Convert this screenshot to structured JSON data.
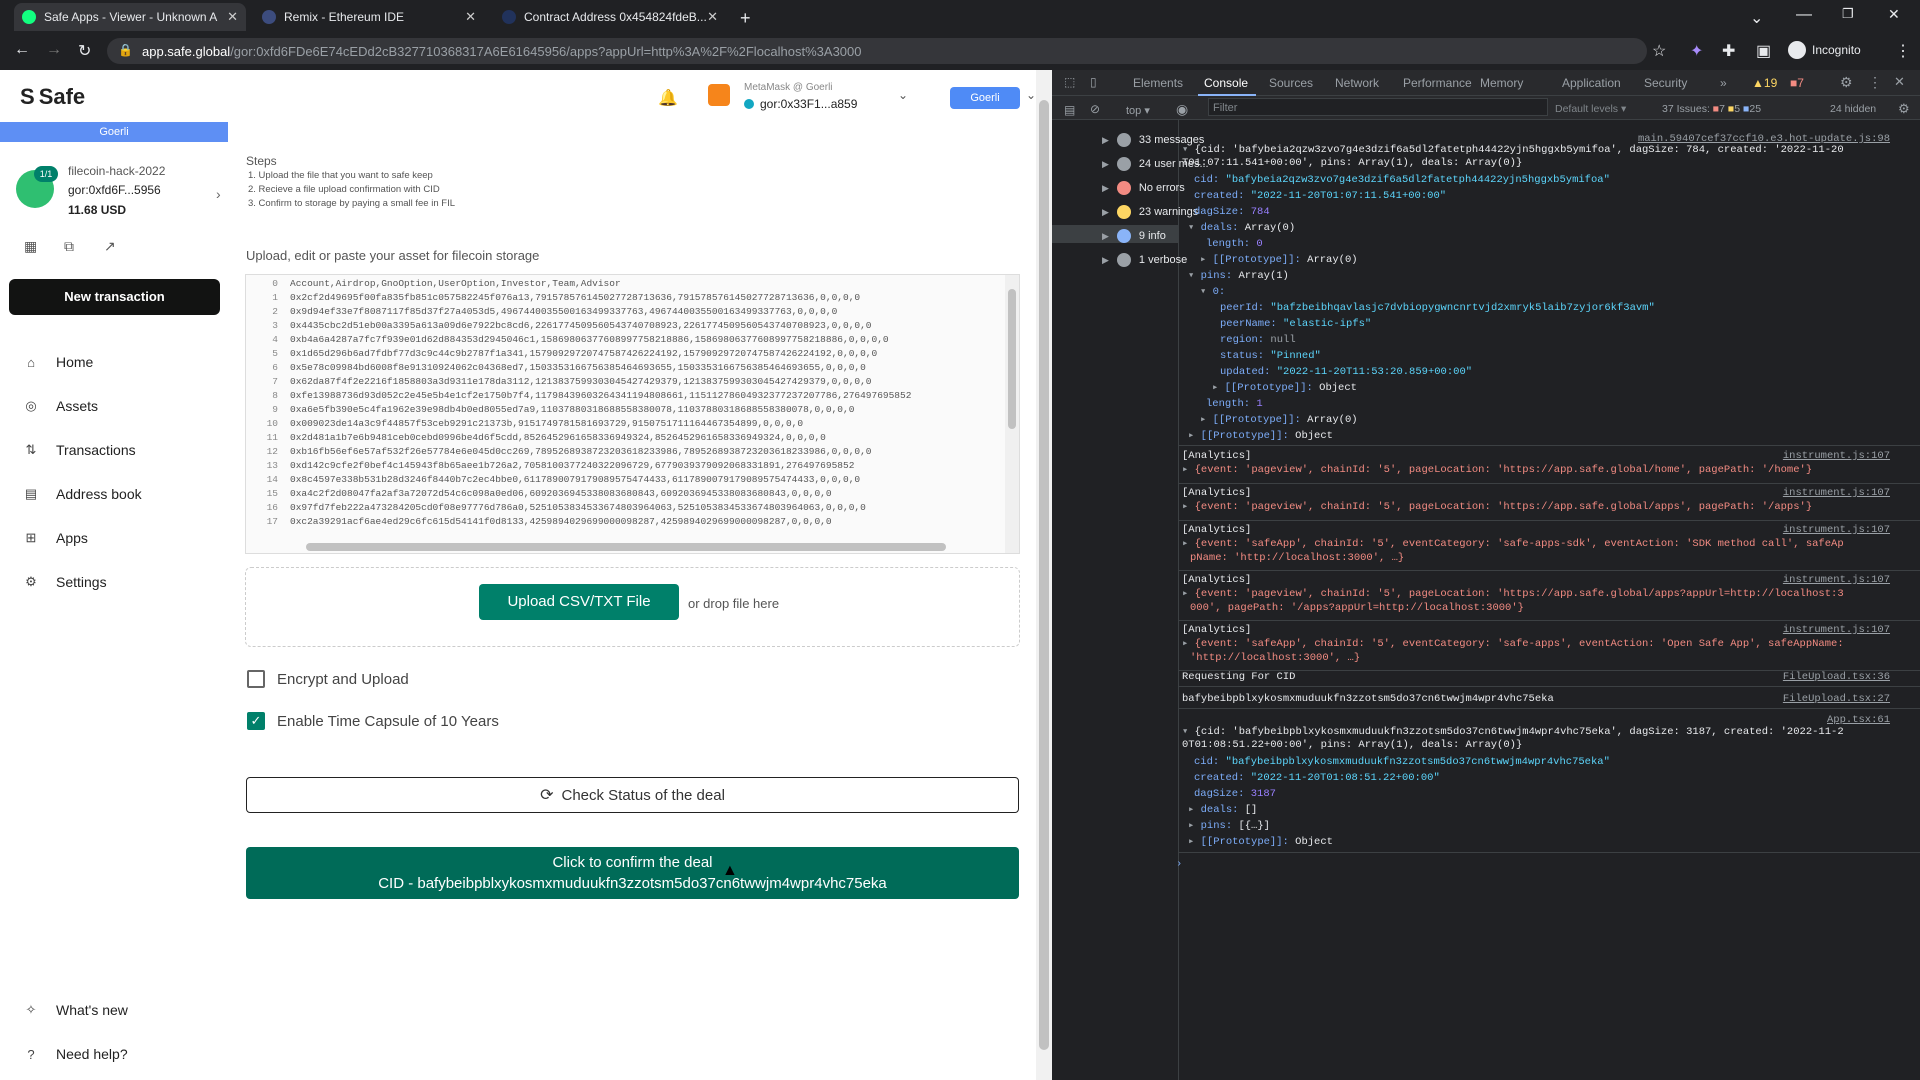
{
  "browser": {
    "tabs": [
      {
        "title": "Safe Apps - Viewer - Unknown A"
      },
      {
        "title": "Remix - Ethereum IDE"
      },
      {
        "title": "Contract Address 0x454824fdeB..."
      }
    ],
    "url_host": "app.safe.global",
    "url_path": "/gor:0xfd6FDe6E74cEDd2cB327710368317A6E61645956/apps?appUrl=http%3A%2F%2Flocalhost%3A3000",
    "profile": "Incognito"
  },
  "safe": {
    "logo": "Safe",
    "network_bar": "Goerli",
    "account": {
      "name": "filecoin-hack-2022",
      "address": "gor:0xfd6F...5956",
      "balance": "11.68 USD",
      "threshold": "1/1"
    },
    "new_tx": "New transaction",
    "nav": [
      {
        "label": "Home",
        "icon": "home-icon"
      },
      {
        "label": "Assets",
        "icon": "assets-icon"
      },
      {
        "label": "Transactions",
        "icon": "transactions-icon"
      },
      {
        "label": "Address book",
        "icon": "address-book-icon"
      },
      {
        "label": "Apps",
        "icon": "apps-icon"
      },
      {
        "label": "Settings",
        "icon": "settings-icon"
      }
    ],
    "whats_new": "What's new",
    "need_help": "Need help?",
    "header": {
      "wallet": "MetaMask @ Goerli",
      "address": "gor:0x33F1...a859",
      "network": "Goerli"
    }
  },
  "app": {
    "steps_title": "Steps",
    "steps": [
      "1. Upload the file that you want to safe keep",
      "2. Recieve a file upload confirmation with CID",
      "3. Confirm to storage by paying a small fee in FIL"
    ],
    "upload_title": "Upload, edit or paste your asset for filecoin storage",
    "csv_lines": [
      "Account,Airdrop,GnoOption,UserOption,Investor,Team,Advisor",
      "0x2cf2d49695f00fa835fb851c057582245f076a13,791578576145027728713636,791578576145027728713636,0,0,0,0",
      "0x9d94ef33e7f8087117f85d37f27a4053d5,4967440035500163499337763,4967440035500163499337763,0,0,0,0",
      "0x4435cbc2d51eb00a3395a613a09d6e7922bc8cd6,2261774509560543740708923,2261774509560543740708923,0,0,0,0",
      "0xb4a6a4287a7fc7f939e01d62d884353d2945046c1,15869806377608997758218886,15869806377608997758218886,0,0,0,0",
      "0x1d65d296b6ad7fdbf77d3c9c44c9b2787f1a341,15790929720747587426224192,15790929720747587426224192,0,0,0,0",
      "0x5e78c09984bd6008f8e91310924062c04368ed7,1503353166756385464693655,1503353166756385464693655,0,0,0,0",
      "0x62da87f4f2e2216f1858803a3d9311e178da3112,1213837599303045427429379,1213837599303045427429379,0,0,0,0",
      "0xfe13988736d93d052c2e45e5b4e1cf2e1750b7f4,11798439603264341194808661,11511278604932377237207786,276497695852",
      "0xa6e5fb390e5c4fa1962e39e98db4b0ed8055ed7a9,11037880318688558380078,11037880318688558380078,0,0,0,0",
      "0x009023de14a3c9f44857f53ceb9291c21373b,9151749781581693729,9150751711164467354899,0,0,0,0",
      "0x2d481a1b7e6b9481ceb0cebd0996be4d6f5cdd,8526452961658336949324,8526452961658336949324,0,0,0,0",
      "0xb16fb56ef6e57af532f26e57784e6e045d0cc269,7895268938723203618233986,7895268938723203618233986,0,0,0,0",
      "0xd142c9cfe2f0bef4c145943f8b65aee1b726a2,7058100377240322096729,6779039379092068331891,276497695852",
      "0x8c4597e338b531b28d3246f8440b7c2ec4bbe0,6117890079179089575474433,6117890079179089575474433,0,0,0,0",
      "0xa4c2f2d08047fa2af3a72072d54c6c098a0ed06,6092036945338083680843,6092036945338083680843,0,0,0,0",
      "0x97fd7feb222a473284205cd0f08e97776d786a0,5251053834533674803964063,5251053834533674803964063,0,0,0,0",
      "0xc2a39291acf6ae4ed29c6fc615d54141f0d8133,4259894029699000098287,4259894029699000098287,0,0,0,0"
    ],
    "upload_button": "Upload CSV/TXT File",
    "drop_text": "or drop file here",
    "encrypt_label": "Encrypt and Upload",
    "encrypt_checked": false,
    "capsule_label": "Enable Time Capsule of 10 Years",
    "capsule_checked": true,
    "check_status": "Check Status of the deal",
    "confirm_line1": "Click to confirm the deal",
    "confirm_line2": "CID - bafybeibpblxykosmxmuduukfn3zzotsm5do37cn6twwjm4wpr4vhc75eka"
  },
  "devtools": {
    "tabs": [
      "Elements",
      "Console",
      "Sources",
      "Network",
      "Performance",
      "Memory",
      "Application",
      "Security"
    ],
    "active_tab": "Console",
    "warn_count": "19",
    "err_count": "7",
    "context": "top",
    "filter_placeholder": "Filter",
    "levels": "Default levels",
    "issues": "37 Issues:",
    "issues_err": "7",
    "issues_warn": "5",
    "issues_info": "25",
    "hidden": "24 hidden",
    "sidebar": [
      {
        "label": "33 messages",
        "color": "#9aa0a6"
      },
      {
        "label": "24 user mes...",
        "color": "#9aa0a6"
      },
      {
        "label": "No errors",
        "color": "#f28b82"
      },
      {
        "label": "23 warnings",
        "color": "#fdd663"
      },
      {
        "label": "9 info",
        "color": "#8ab4f8"
      },
      {
        "label": "1 verbose",
        "color": "#9aa0a6"
      }
    ],
    "src_main": "main.59407cef37ccf10.e3.hot-update.js:98",
    "src_instr": "instrument.js:107",
    "src_file36": "FileUpload.tsx:36",
    "src_file27": "FileUpload.tsx:27",
    "src_app": "App.tsx:61",
    "obj1_head": "{cid: 'bafybeia2qzw3zvo7g4e3dzif6a5dl2fatetph44422yjn5hggxb5ymifoa', dagSize: 784, created: '2022-11-20",
    "obj1_head2": "T01:07:11.541+00:00', pins: Array(1), deals: Array(0)}",
    "obj1_cid": "\"bafybeia2qzw3zvo7g4e3dzif6a5dl2fatetph44422yjn5hggxb5ymifoa\"",
    "obj1_created": "\"2022-11-20T01:07:11.541+00:00\"",
    "obj1_dagsize": "784",
    "peer_id": "\"bafzbeibhqavlasjc7dvbiopygwncnrtvjd2xmryk5laib7zyjor6kf3avm\"",
    "peer_name": "\"elastic-ipfs\"",
    "region": "null",
    "status": "\"Pinned\"",
    "updated": "\"2022-11-20T11:53:20.859+00:00\"",
    "analytics": [
      {
        "l1": "{event: 'pageview', chainId: '5', pageLocation: 'https://app.safe.global/home', pagePath: '/home'}",
        "l2": ""
      },
      {
        "l1": "{event: 'pageview', chainId: '5', pageLocation: 'https://app.safe.global/apps', pagePath: '/apps'}",
        "l2": ""
      },
      {
        "l1": "{event: 'safeApp', chainId: '5', eventCategory: 'safe-apps-sdk', eventAction: 'SDK method call', safeAp",
        "l2": "pName: 'http://localhost:3000', …}"
      },
      {
        "l1": "{event: 'pageview', chainId: '5', pageLocation: 'https://app.safe.global/apps?appUrl=http://localhost:3",
        "l2": "000', pagePath: '/apps?appUrl=http://localhost:3000'}"
      },
      {
        "l1": "{event: 'safeApp', chainId: '5', eventCategory: 'safe-apps', eventAction: 'Open Safe App', safeAppName:",
        "l2": "'http://localhost:3000', …}"
      }
    ],
    "analytics_label": "[Analytics]",
    "requesting": "Requesting For CID",
    "cid_log": "bafybeibpblxykosmxmuduukfn3zzotsm5do37cn6twwjm4wpr4vhc75eka",
    "obj2_head": "{cid: 'bafybeibpblxykosmxmuduukfn3zzotsm5do37cn6twwjm4wpr4vhc75eka', dagSize: 3187, created: '2022-11-2",
    "obj2_head2": "0T01:08:51.22+00:00', pins: Array(1), deals: Array(0)}",
    "obj2_cid": "\"bafybeibpblxykosmxmuduukfn3zzotsm5do37cn6twwjm4wpr4vhc75eka\"",
    "obj2_created": "\"2022-11-20T01:08:51.22+00:00\"",
    "obj2_dagsize": "3187"
  }
}
